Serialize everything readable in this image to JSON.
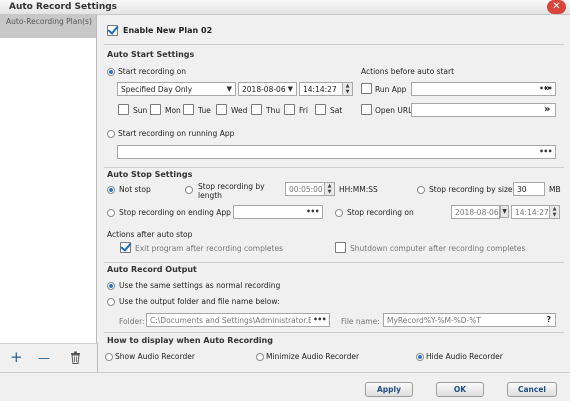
{
  "window": {
    "title": "Auto Record Settings",
    "close_glyph": "✕"
  },
  "sidebar": {
    "items": [
      {
        "label": "Auto-Recording Plan(s)"
      }
    ],
    "tools": {
      "add": "+",
      "remove": "—",
      "delete_icon": "trash-icon"
    }
  },
  "plan": {
    "enable_label": "Enable New Plan 02",
    "enabled": true
  },
  "auto_start": {
    "title": "Auto Start Settings",
    "start_on_label": "Start recording on",
    "schedule_value": "Specified Day Only",
    "date_value": "2018-08-06",
    "time_value": "14:14:27",
    "weekdays": [
      "Sun",
      "Mon",
      "Tue",
      "Wed",
      "Thu",
      "Fri",
      "Sat"
    ],
    "actions_title": "Actions before auto start",
    "run_app_label": "Run App",
    "open_url_label": "Open URL",
    "running_app_label": "Start recording on running App"
  },
  "auto_stop": {
    "title": "Auto Stop Settings",
    "not_stop_label": "Not stop",
    "by_length_label": "Stop recording by length",
    "length_value": "00:05:00",
    "length_unit": "HH:MM:SS",
    "by_size_label": "Stop recording by size",
    "size_value": "30",
    "size_unit": "MB",
    "ending_app_label": "Stop recording on ending App",
    "stop_on_label": "Stop recording on",
    "stop_date_value": "2018-08-06",
    "stop_time_value": "14:14:27",
    "actions_title": "Actions after auto stop",
    "exit_label": "Exit program after recording completes",
    "exit_checked": true,
    "shutdown_label": "Shutdown computer after recording completes"
  },
  "output": {
    "title": "Auto Record Output",
    "same_label": "Use the same settings as normal recording",
    "folder_option_label": "Use the output folder and file name below:",
    "folder_label": "Folder:",
    "folder_value": "C:\\Documents and Settings\\Administrator.B!",
    "filename_label": "File name:",
    "filename_value": "MyRecord%Y-%M-%D-%T",
    "help": "?"
  },
  "display": {
    "title": "How to display when Auto Recording",
    "show_label": "Show Audio Recorder",
    "minimize_label": "Minimize Audio Recorder",
    "hide_label": "Hide Audio Recorder"
  },
  "buttons": {
    "apply": "Apply",
    "ok": "OK",
    "cancel": "Cancel"
  },
  "glyphs": {
    "dots": "•••",
    "forward": "»",
    "dropdown": "▼",
    "up": "▲",
    "down": "▼",
    "cal": "▦"
  },
  "colors": {
    "accent": "#2f77c9",
    "close": "#d9443d",
    "button_text": "#1f4f86"
  }
}
